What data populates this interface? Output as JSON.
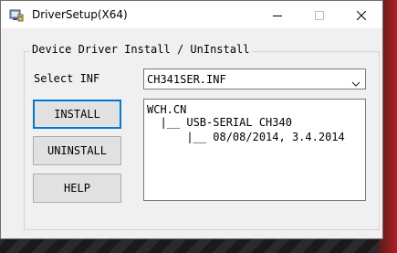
{
  "window": {
    "title": "DriverSetup(X64)",
    "icon": "driver-setup-icon",
    "controls": [
      "minimize-icon",
      "maximize-icon",
      "close-icon"
    ]
  },
  "group": {
    "legend": "Device Driver Install / UnInstall"
  },
  "select_inf": {
    "label": "Select INF",
    "value": "CH341SER.INF"
  },
  "buttons": {
    "install": "INSTALL",
    "uninstall": "UNINSTALL",
    "help": "HELP"
  },
  "info": {
    "lines": [
      "WCH.CN",
      "  |__ USB-SERIAL CH340",
      "      |__ 08/08/2014, 3.4.2014"
    ]
  },
  "colors": {
    "default_button_border": "#0078d7",
    "window_bg": "#f0f0f0"
  }
}
